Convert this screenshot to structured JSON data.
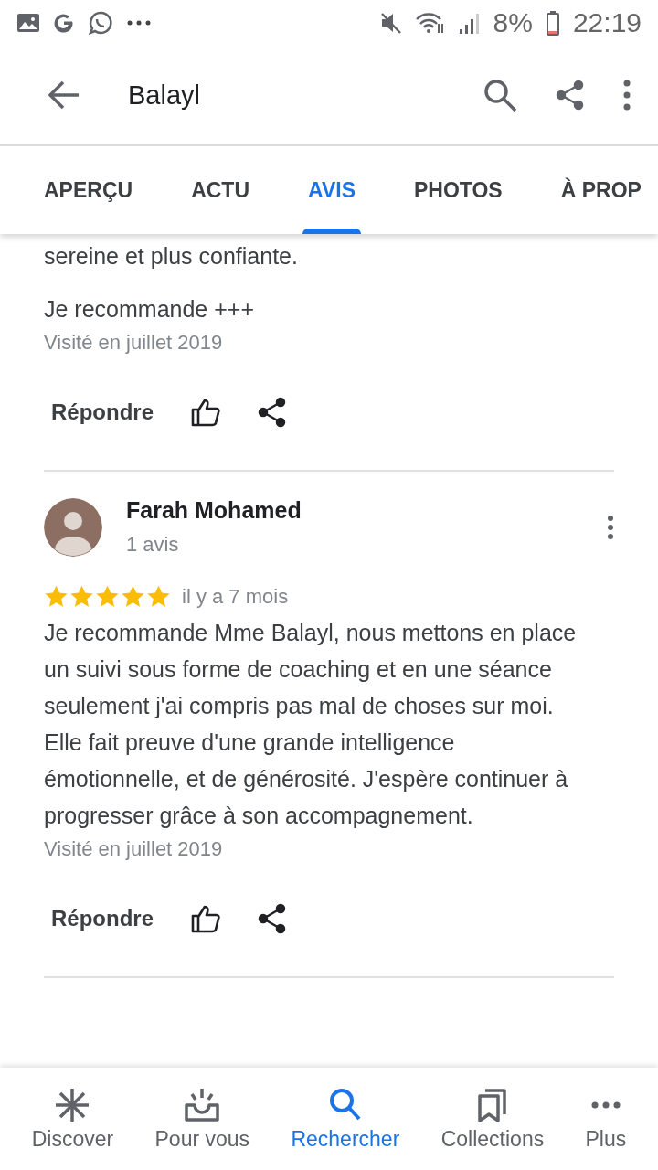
{
  "status_bar": {
    "battery": "8%",
    "time": "22:19"
  },
  "app_bar": {
    "title": "Balayl"
  },
  "tabs": [
    {
      "label": "APERÇU",
      "selected": false
    },
    {
      "label": "ACTU",
      "selected": false
    },
    {
      "label": "AVIS",
      "selected": true
    },
    {
      "label": "PHOTOS",
      "selected": false
    },
    {
      "label": "À PROP",
      "selected": false
    }
  ],
  "reviews": [
    {
      "paragraphs": [
        "sereine et plus confiante.",
        "Je recommande +++"
      ],
      "visited": "Visité en juillet 2019",
      "reply": "Répondre"
    },
    {
      "author": "Farah Mohamed",
      "count": "1 avis",
      "stars": 5,
      "time": "il y a 7 mois",
      "paragraphs": [
        "Je recommande Mme Balayl, nous mettons en place un suivi sous forme de coaching et en une séance seulement j'ai compris pas mal de choses sur moi. Elle fait preuve d'une grande intelligence émotionnelle, et de générosité. J'espère continuer à progresser grâce à son accompagnement."
      ],
      "visited": "Visité en juillet 2019",
      "reply": "Répondre"
    }
  ],
  "bottom_nav": [
    {
      "label": "Discover",
      "kind": "asterisk",
      "selected": false
    },
    {
      "label": "Pour vous",
      "kind": "inbox",
      "selected": false
    },
    {
      "label": "Rechercher",
      "kind": "search",
      "selected": true
    },
    {
      "label": "Collections",
      "kind": "bookmarks",
      "selected": false
    },
    {
      "label": "Plus",
      "kind": "more",
      "selected": false
    }
  ]
}
